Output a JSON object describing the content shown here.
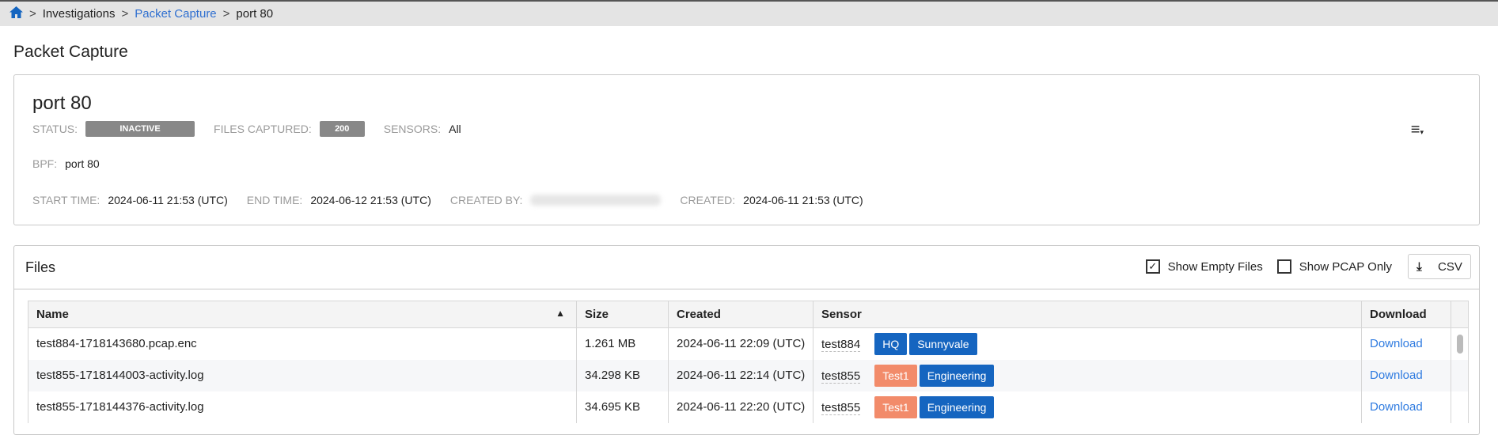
{
  "breadcrumb": {
    "items": [
      "Investigations",
      "Packet Capture",
      "port 80"
    ],
    "sep": ">"
  },
  "page_title": "Packet Capture",
  "capture": {
    "name": "port 80",
    "status_label": "STATUS:",
    "status": "INACTIVE",
    "files_label": "FILES CAPTURED:",
    "files": "200",
    "sensors_label": "SENSORS:",
    "sensors": "All",
    "bpf_label": "BPF:",
    "bpf": "port 80",
    "start_label": "START TIME:",
    "start": "2024-06-11 21:53 (UTC)",
    "end_label": "END TIME:",
    "end": "2024-06-12 21:53 (UTC)",
    "created_by_label": "CREATED BY:",
    "created_label": "CREATED:",
    "created": "2024-06-11 21:53 (UTC)"
  },
  "files": {
    "title": "Files",
    "show_empty": "Show Empty Files",
    "show_empty_checked": true,
    "show_pcap": "Show PCAP Only",
    "show_pcap_checked": false,
    "csv": "CSV",
    "columns": [
      "Name",
      "Size",
      "Created",
      "Sensor",
      "Download"
    ],
    "rows": [
      {
        "name": "test884-1718143680.pcap.enc",
        "size": "1.261 MB",
        "created": "2024-06-11 22:09 (UTC)",
        "sensor": "test884",
        "tags": [
          {
            "t": "HQ",
            "c": "#1565c0"
          },
          {
            "t": "Sunnyvale",
            "c": "#1565c0"
          }
        ],
        "download": "Download"
      },
      {
        "name": "test855-1718144003-activity.log",
        "size": "34.298 KB",
        "created": "2024-06-11 22:14 (UTC)",
        "sensor": "test855",
        "tags": [
          {
            "t": "Test1",
            "c": "#f28b6a"
          },
          {
            "t": "Engineering",
            "c": "#1565c0"
          }
        ],
        "download": "Download"
      },
      {
        "name": "test855-1718144376-activity.log",
        "size": "34.695 KB",
        "created": "2024-06-11 22:20 (UTC)",
        "sensor": "test855",
        "tags": [
          {
            "t": "Test1",
            "c": "#f28b6a"
          },
          {
            "t": "Engineering",
            "c": "#1565c0"
          }
        ],
        "download": "Download"
      }
    ]
  }
}
